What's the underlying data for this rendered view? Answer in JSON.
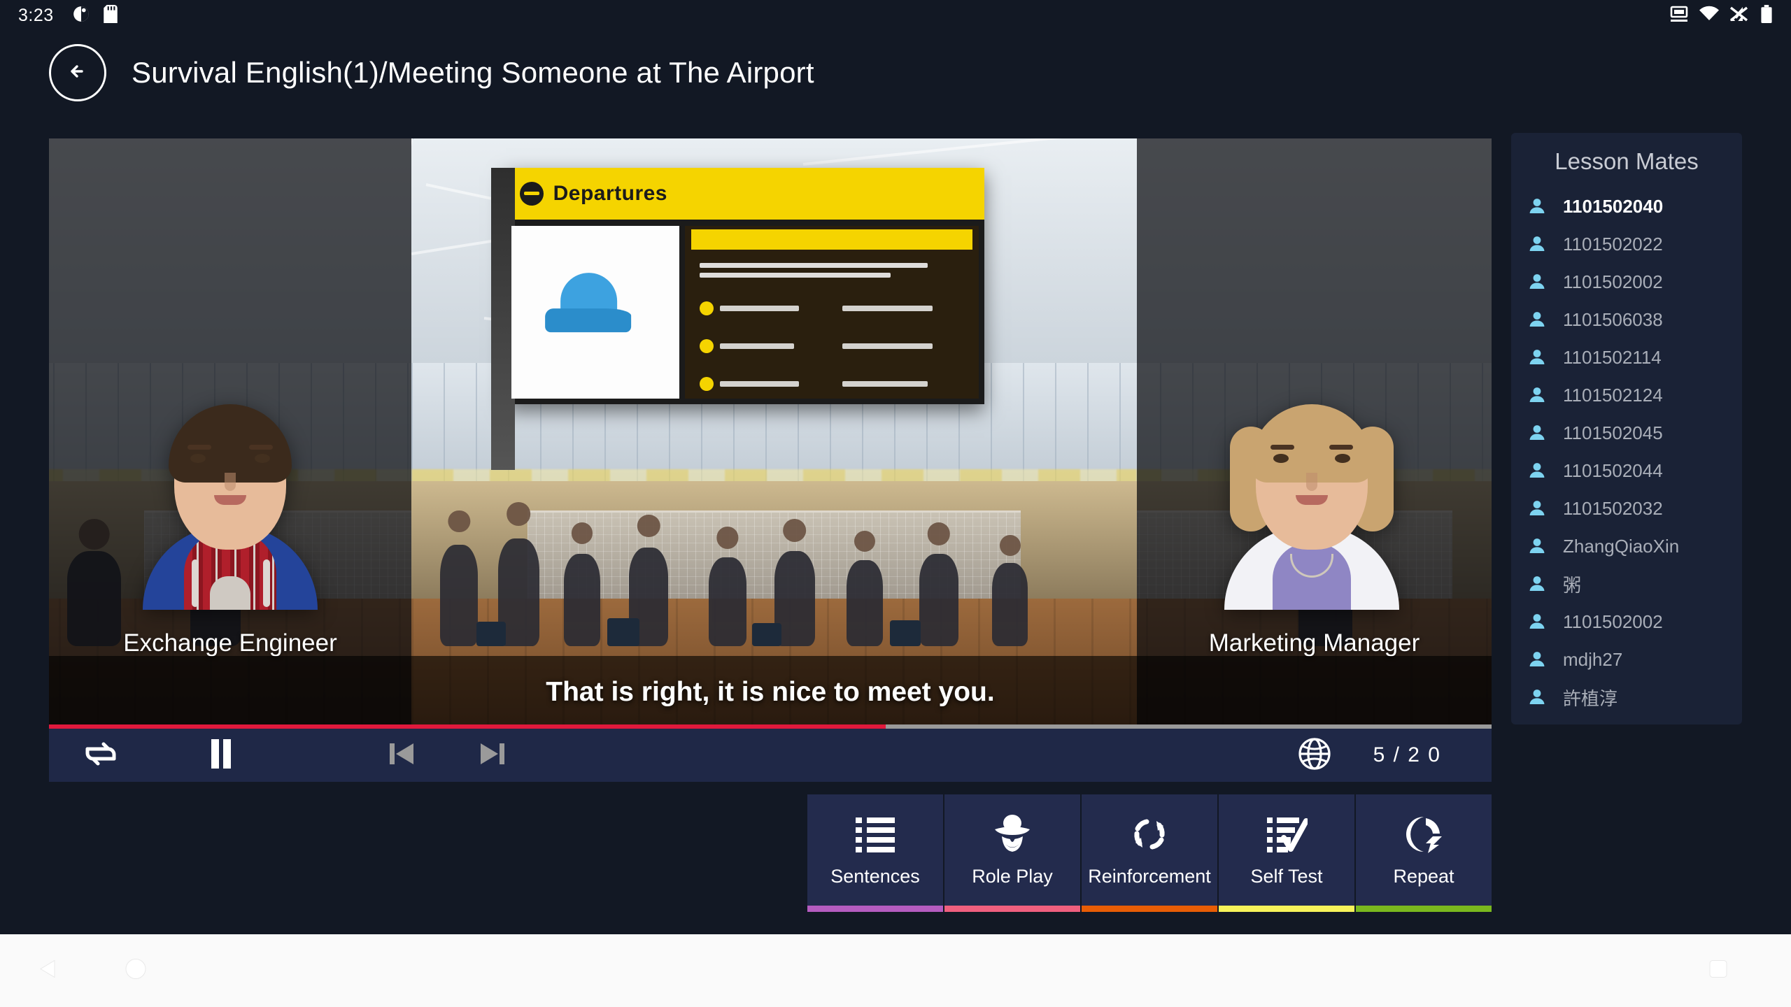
{
  "statusbar": {
    "time": "3:23",
    "left_icons": [
      "screen-rotation-icon",
      "sd-card-icon"
    ],
    "right_icons": [
      "cast-screen-icon",
      "wifi-icon",
      "signal-muted-icon",
      "battery-icon"
    ]
  },
  "header": {
    "back_icon": "back-arrow-icon",
    "title": "Survival English(1)/Meeting Someone at The Airport"
  },
  "stage": {
    "left_role": "Exchange Engineer",
    "right_role": "Marketing Manager",
    "subtitle": "That is right, it is nice to meet you.",
    "scene_sign_text": "Departures"
  },
  "player": {
    "progress_percent": 58,
    "progress_color": "#e0193c",
    "repeat_icon": "repeat-icon",
    "pause_icon": "pause-icon",
    "prev_icon": "previous-track-icon",
    "next_icon": "next-track-icon",
    "globe_icon": "globe-icon",
    "counter": "5 / 2 0"
  },
  "actions": [
    {
      "label": "Sentences",
      "icon": "list-icon",
      "color": "#b55cc0"
    },
    {
      "label": "Role Play",
      "icon": "actor-mask-icon",
      "color": "#ef5f7e"
    },
    {
      "label": "Reinforcement",
      "icon": "refresh-cycle-icon",
      "color": "#e85d06"
    },
    {
      "label": "Self Test",
      "icon": "checklist-icon",
      "color": "#f7f35a"
    },
    {
      "label": "Repeat",
      "icon": "speaker-loop-icon",
      "color": "#7ab81e"
    }
  ],
  "mates": {
    "title": "Lesson Mates",
    "items": [
      {
        "name": "1101502040",
        "active": true
      },
      {
        "name": "1101502022",
        "active": false
      },
      {
        "name": "1101502002",
        "active": false
      },
      {
        "name": "1101506038",
        "active": false
      },
      {
        "name": "1101502114",
        "active": false
      },
      {
        "name": "1101502124",
        "active": false
      },
      {
        "name": "1101502045",
        "active": false
      },
      {
        "name": "1101502044",
        "active": false
      },
      {
        "name": "1101502032",
        "active": false
      },
      {
        "name": "ZhangQiaoXin",
        "active": false
      },
      {
        "name": "粥",
        "active": false
      },
      {
        "name": "1101502002",
        "active": false
      },
      {
        "name": "mdjh27",
        "active": false
      },
      {
        "name": "許植淳",
        "active": false
      }
    ]
  },
  "navbar": {
    "back_icon": "nav-back-triangle-icon",
    "home_icon": "nav-home-circle-icon",
    "recents_icon": "nav-recents-square-icon"
  }
}
